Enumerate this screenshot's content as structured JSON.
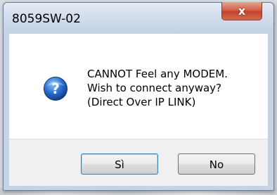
{
  "window": {
    "title": "8059SW-02",
    "close_glyph": "x"
  },
  "message": {
    "icon": "question-icon",
    "lines": [
      "CANNOT Feel any MODEM.",
      "Wish to connect anyway?",
      "(Direct Over IP LINK)"
    ]
  },
  "buttons": {
    "yes_label": "Sì",
    "no_label": "No"
  },
  "colors": {
    "accent": "#3c7fb1",
    "close_red": "#c0432c",
    "icon_blue": "#2461b8"
  }
}
